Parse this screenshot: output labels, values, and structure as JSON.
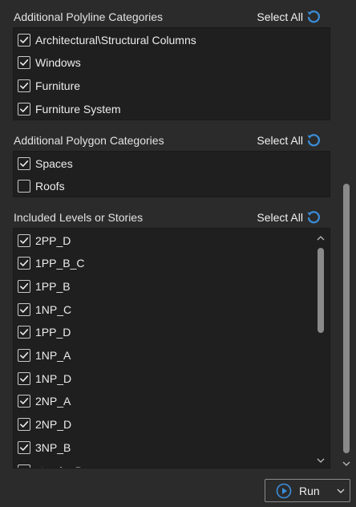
{
  "polyline": {
    "title": "Additional Polyline Categories",
    "select_all": "Select All",
    "reset_icon": "reset-icon",
    "items": [
      {
        "label": "Architectural\\Structural Columns",
        "checked": true
      },
      {
        "label": "Windows",
        "checked": true
      },
      {
        "label": "Furniture",
        "checked": true
      },
      {
        "label": "Furniture System",
        "checked": true
      }
    ]
  },
  "polygon": {
    "title": "Additional Polygon Categories",
    "select_all": "Select All",
    "reset_icon": "reset-icon",
    "items": [
      {
        "label": "Spaces",
        "checked": true
      },
      {
        "label": "Roofs",
        "checked": false
      }
    ]
  },
  "levels": {
    "title": "Included Levels or Stories",
    "select_all": "Select All",
    "reset_icon": "reset-icon",
    "items": [
      {
        "label": "2PP_D",
        "checked": true
      },
      {
        "label": "1PP_B_C",
        "checked": true
      },
      {
        "label": "1PP_B",
        "checked": true
      },
      {
        "label": "1NP_C",
        "checked": true
      },
      {
        "label": "1PP_D",
        "checked": true
      },
      {
        "label": "1NP_A",
        "checked": true
      },
      {
        "label": "1NP_D",
        "checked": true
      },
      {
        "label": "2NP_A",
        "checked": true
      },
      {
        "label": "2NP_D",
        "checked": true
      },
      {
        "label": "3NP_B",
        "checked": true
      },
      {
        "label": "strecha D",
        "checked": true
      }
    ]
  },
  "footer": {
    "run_label": "Run",
    "run_icon": "play-icon"
  },
  "colors": {
    "accent": "#3a8fdc",
    "background": "#2b2b2b",
    "list_background": "#1f1f1f"
  }
}
